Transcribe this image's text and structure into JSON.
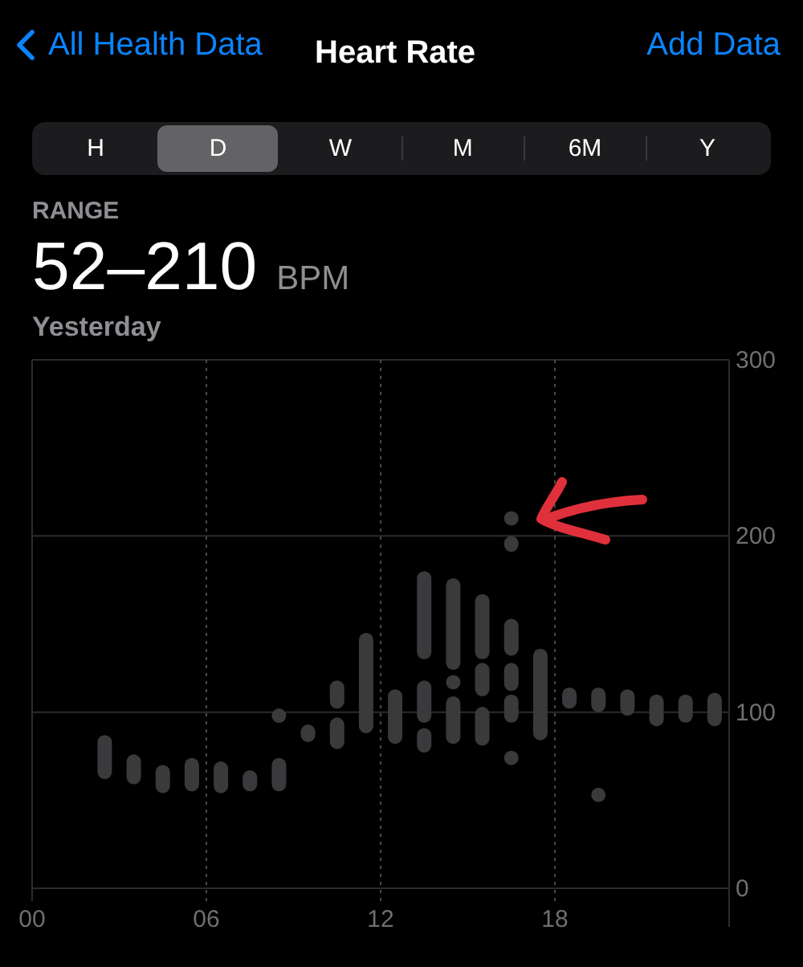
{
  "nav": {
    "back": "All Health Data",
    "title": "Heart Rate",
    "action": "Add Data"
  },
  "periods": [
    {
      "label": "H",
      "selected": false
    },
    {
      "label": "D",
      "selected": true
    },
    {
      "label": "W",
      "selected": false
    },
    {
      "label": "M",
      "selected": false
    },
    {
      "label": "6M",
      "selected": false
    },
    {
      "label": "Y",
      "selected": false
    }
  ],
  "summary": {
    "label": "RANGE",
    "value": "52–210",
    "unit": "BPM",
    "date": "Yesterday"
  },
  "chart_data": {
    "type": "candlestick",
    "grid": true,
    "ylim": [
      0,
      300
    ],
    "yticks": [
      0,
      100,
      200,
      300
    ],
    "xlim": [
      0,
      24
    ],
    "xticks": [
      {
        "value": 0,
        "label": "00"
      },
      {
        "value": 6,
        "label": "06"
      },
      {
        "value": 12,
        "label": "12"
      },
      {
        "value": 18,
        "label": "18"
      }
    ],
    "x": [
      2.5,
      3.5,
      4.5,
      5.5,
      6.5,
      7.5,
      8.5,
      9.5,
      10.5,
      11.5,
      12.5,
      13.5,
      14.5,
      15.5,
      16.5,
      17.5,
      18.5,
      19.5,
      20.5,
      21.5,
      22.5,
      23.5
    ],
    "series": [
      {
        "color": "#3a3a3c",
        "ohlc": [
          [
            62,
            87,
            62,
            87
          ],
          [
            59,
            76,
            59,
            76
          ],
          [
            54,
            70,
            54,
            70
          ],
          [
            55,
            74,
            55,
            74
          ],
          [
            54,
            72,
            54,
            72
          ],
          [
            55,
            67,
            55,
            67
          ],
          [
            55,
            74,
            55,
            74
          ],
          [
            83,
            93,
            83,
            93
          ],
          [
            79,
            97,
            79,
            97
          ],
          [
            88,
            145,
            88,
            145
          ],
          [
            82,
            113,
            82,
            113
          ],
          [
            77,
            91,
            77,
            91
          ],
          [
            82,
            109,
            82,
            109
          ],
          [
            81,
            103,
            81,
            103
          ],
          [
            70,
            78,
            70,
            78
          ],
          [
            84,
            136,
            84,
            136
          ],
          [
            102,
            114,
            102,
            114
          ],
          [
            49,
            57,
            49,
            57
          ],
          [
            98,
            113,
            98,
            113
          ],
          [
            92,
            110,
            92,
            110
          ],
          [
            94,
            110,
            94,
            110
          ],
          [
            92,
            111,
            92,
            111
          ]
        ]
      },
      {
        "color": "#3a3a3c",
        "ohlc": [
          null,
          null,
          null,
          null,
          null,
          null,
          [
            94,
            102,
            94,
            102
          ],
          null,
          [
            102,
            118,
            102,
            118
          ],
          null,
          null,
          [
            94,
            118,
            94,
            118
          ],
          [
            113,
            121,
            113,
            121
          ],
          [
            109,
            128,
            109,
            128
          ],
          [
            94,
            110,
            94,
            110
          ],
          null,
          null,
          [
            100,
            114,
            100,
            114
          ],
          null,
          null,
          null,
          null
        ]
      },
      {
        "color": "#3a3a3c",
        "ohlc": [
          null,
          null,
          null,
          null,
          null,
          null,
          null,
          null,
          null,
          null,
          null,
          [
            130,
            180,
            130,
            180
          ],
          [
            124,
            176,
            124,
            176
          ],
          [
            130,
            167,
            130,
            167
          ],
          [
            112,
            128,
            112,
            128
          ],
          null,
          null,
          null,
          null,
          null,
          null,
          null
        ]
      },
      {
        "color": "#3a3a3c",
        "ohlc": [
          null,
          null,
          null,
          null,
          null,
          null,
          null,
          null,
          null,
          null,
          null,
          null,
          null,
          null,
          [
            132,
            153,
            132,
            153
          ],
          null,
          null,
          null,
          null,
          null,
          null,
          null
        ]
      },
      {
        "color": "#3a3a3c",
        "ohlc": [
          null,
          null,
          null,
          null,
          null,
          null,
          null,
          null,
          null,
          null,
          null,
          null,
          null,
          null,
          [
            191,
            200,
            191,
            200
          ],
          null,
          null,
          null,
          null,
          null,
          null,
          null
        ]
      },
      {
        "color": "#3a3a3c",
        "ohlc": [
          null,
          null,
          null,
          null,
          null,
          null,
          null,
          null,
          null,
          null,
          null,
          null,
          null,
          null,
          [
            206,
            214,
            206,
            214
          ],
          null,
          null,
          null,
          null,
          null,
          null,
          null
        ]
      }
    ]
  }
}
